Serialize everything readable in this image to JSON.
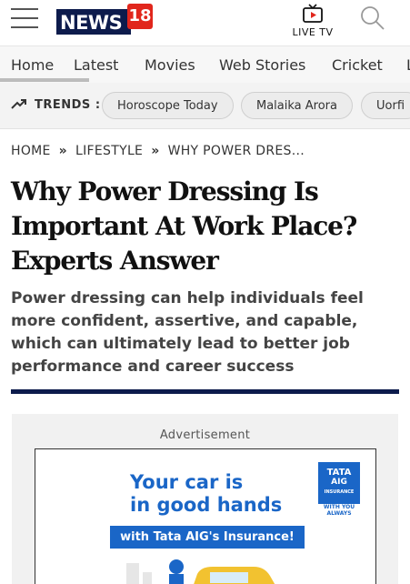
{
  "header": {
    "logo_word": "NEWS",
    "logo_number": "18",
    "live_tv_label": "LIVE TV"
  },
  "nav": {
    "items": [
      "Home",
      "Latest",
      "Movies",
      "Web Stories",
      "Cricket",
      "L"
    ],
    "active": "Home"
  },
  "trends": {
    "label": "TRENDS :",
    "chips": [
      "Horoscope Today",
      "Malaika Arora",
      "Uorfi"
    ]
  },
  "breadcrumb": {
    "items": [
      "HOME",
      "LIFESTYLE",
      "WHY POWER DRES..."
    ],
    "separator": "»"
  },
  "article": {
    "headline": " Why Power Dressing Is Important At Work Place? Experts Answer",
    "summary": "Power dressing can help individuals feel more confident, assertive, and capable, which can ultimately lead to better job performance and career success"
  },
  "ad": {
    "label": "Advertisement",
    "headline_line1": "Your car is",
    "headline_line2": "in good hands",
    "band_text": "with Tata AIG's Insurance!",
    "brand_line1": "TATA",
    "brand_line2": "AIG",
    "brand_line3": "INSURANCE",
    "brand_tagline": "WITH YOU ALWAYS"
  },
  "colors": {
    "brand_navy": "#0d1b4c",
    "brand_red": "#e1261c",
    "ad_blue": "#1a66c7"
  },
  "icons": [
    "hamburger-menu-icon",
    "live-tv-icon",
    "search-icon",
    "trending-icon"
  ]
}
